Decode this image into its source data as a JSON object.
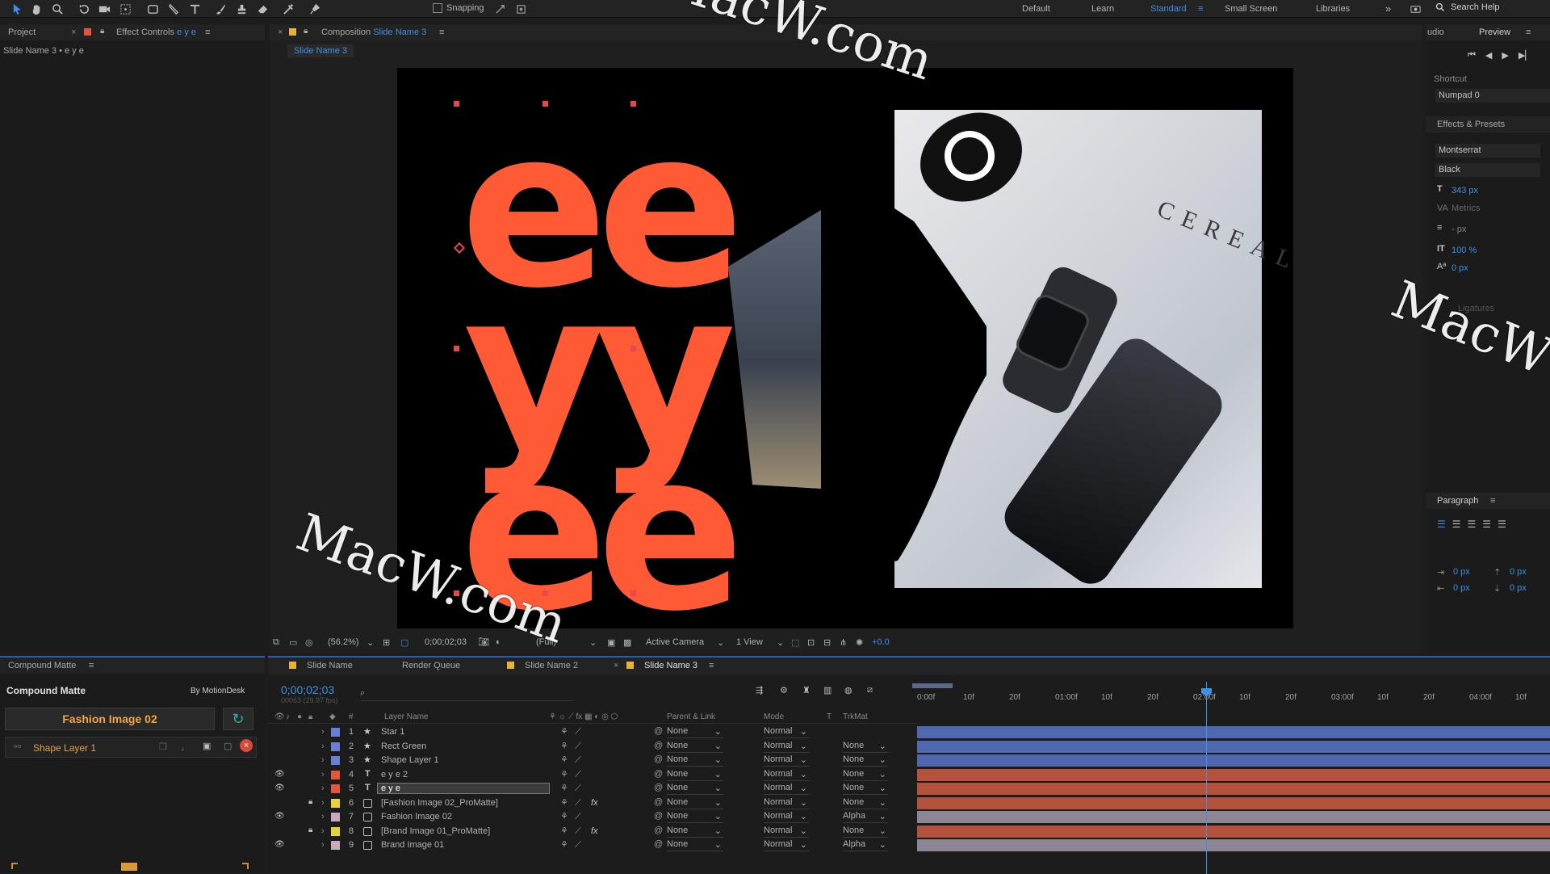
{
  "toolbar": {
    "snapping_label": "Snapping",
    "workspaces": [
      "Default",
      "Learn",
      "Standard",
      "Small Screen",
      "Libraries"
    ],
    "active_workspace": "Standard",
    "search_placeholder": "Search Help"
  },
  "project_panel": {
    "tab_project": "Project",
    "tab_effect_controls": "Effect Controls",
    "effect_controls_layer": "e y e",
    "breadcrumb": "Slide Name 3 • e y e"
  },
  "composition_panel": {
    "tab_label": "Composition",
    "comp_name": "Slide Name 3",
    "subtab": "Slide Name 3",
    "canvas_letters": [
      "ee",
      "yy",
      "ee"
    ],
    "viewer_controls": {
      "zoom": "(56.2%)",
      "timecode": "0;00;02;03",
      "resolution": "(Full)",
      "camera": "Active Camera",
      "views": "1 View",
      "exposure": "+0.0"
    }
  },
  "right_panel": {
    "tab_audio": "udio",
    "tab_preview": "Preview",
    "shortcut_label": "Shortcut",
    "shortcut_value": "Numpad 0",
    "effects_presets": "Effects & Presets",
    "character": {
      "font": "Montserrat",
      "style": "Black",
      "size": "343 px",
      "tracking": "Metrics",
      "leading": "- px",
      "scale": "100 %",
      "baseline": "0 px",
      "ligatures": "Ligatures"
    },
    "paragraph_label": "Paragraph",
    "paragraph_values": [
      "0 px",
      "0 px",
      "0 px",
      "0 px"
    ]
  },
  "compound_matte": {
    "tab_label": "Compound Matte",
    "title": "Compound Matte",
    "by": "By MotionDesk",
    "source": "Fashion Image 02",
    "shape_layer": "Shape Layer 1"
  },
  "timeline": {
    "tabs": [
      "Slide Name",
      "Render Queue",
      "Slide Name 2",
      "Slide Name 3"
    ],
    "active_tab": "Slide Name 3",
    "timecode": "0;00;02;03",
    "frame_info": "00063 (29.97 fps)",
    "columns": {
      "num": "#",
      "layer_name": "Layer Name",
      "parent": "Parent & Link",
      "mode": "Mode",
      "t": "T",
      "trkmat": "TrkMat"
    },
    "ruler": [
      "0:00f",
      "10f",
      "20f",
      "01:00f",
      "10f",
      "20f",
      "02:00f",
      "10f",
      "20f",
      "03:00f",
      "10f",
      "20f",
      "04:00f",
      "10f"
    ],
    "playhead_time": "02:03",
    "layers": [
      {
        "num": "1",
        "name": "Star 1",
        "type": "shape",
        "color": "#6b7fd6",
        "parent": "None",
        "mode": "Normal",
        "trkmat": "",
        "track_color": "#5068b0",
        "eye": false,
        "lock": false,
        "fx": false
      },
      {
        "num": "2",
        "name": "Rect Green",
        "type": "shape",
        "color": "#6b7fd6",
        "parent": "None",
        "mode": "Normal",
        "trkmat": "None",
        "track_color": "#5068b0",
        "eye": false,
        "lock": false,
        "fx": false
      },
      {
        "num": "3",
        "name": "Shape Layer 1",
        "type": "shape",
        "color": "#6b7fd6",
        "parent": "None",
        "mode": "Normal",
        "trkmat": "None",
        "track_color": "#5068b0",
        "eye": false,
        "lock": false,
        "fx": false
      },
      {
        "num": "4",
        "name": "e y e 2",
        "type": "text",
        "color": "#e5543d",
        "parent": "None",
        "mode": "Normal",
        "trkmat": "None",
        "track_color": "#b4523e",
        "eye": true,
        "lock": false,
        "fx": false
      },
      {
        "num": "5",
        "name": "e y e",
        "type": "text",
        "color": "#e5543d",
        "parent": "None",
        "mode": "Normal",
        "trkmat": "None",
        "track_color": "#b4523e",
        "eye": true,
        "lock": false,
        "fx": false,
        "selected": true
      },
      {
        "num": "6",
        "name": "[Fashion Image 02_ProMatte]",
        "type": "solid",
        "color": "#e8d23a",
        "parent": "None",
        "mode": "Normal",
        "trkmat": "None",
        "track_color": "#b4523e",
        "eye": false,
        "lock": true,
        "fx": true
      },
      {
        "num": "7",
        "name": "Fashion Image 02",
        "type": "footage",
        "color": "#c9a9c0",
        "parent": "None",
        "mode": "Normal",
        "trkmat": "Alpha",
        "track_color": "#8d8694",
        "eye": true,
        "lock": false,
        "fx": false
      },
      {
        "num": "8",
        "name": "[Brand Image 01_ProMatte]",
        "type": "solid",
        "color": "#e8d23a",
        "parent": "None",
        "mode": "Normal",
        "trkmat": "None",
        "track_color": "#b4523e",
        "eye": false,
        "lock": true,
        "fx": true
      },
      {
        "num": "9",
        "name": "Brand Image 01",
        "type": "footage",
        "color": "#c9a9c0",
        "parent": "None",
        "mode": "Normal",
        "trkmat": "Alpha",
        "track_color": "#8d8694",
        "eye": true,
        "lock": false,
        "fx": false
      }
    ]
  },
  "watermarks": [
    "MacW.com",
    "MacW.com",
    "MacW"
  ],
  "colors": {
    "accent": "#3e8fe8",
    "brand_orange": "#ff5a36",
    "panel_bg": "#1b1b1b",
    "header_bg": "#232323"
  }
}
